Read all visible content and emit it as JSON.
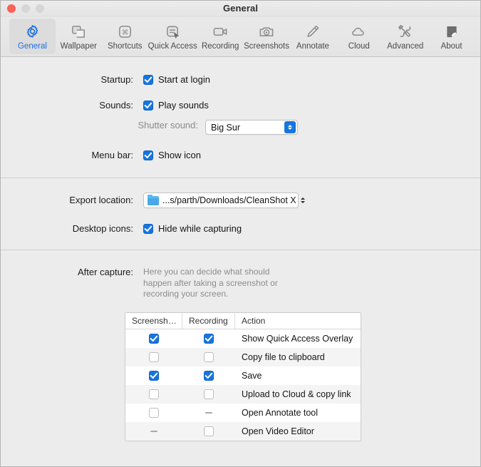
{
  "window": {
    "title": "General",
    "traffic_lights": [
      "close",
      "minimize",
      "zoom"
    ]
  },
  "toolbar": {
    "items": [
      {
        "label": "General",
        "icon": "gear-icon",
        "selected": true
      },
      {
        "label": "Wallpaper",
        "icon": "windows-icon",
        "selected": false
      },
      {
        "label": "Shortcuts",
        "icon": "command-key-icon",
        "selected": false
      },
      {
        "label": "Quick Access",
        "icon": "cursor-panel-icon",
        "selected": false
      },
      {
        "label": "Recording",
        "icon": "video-camera-icon",
        "selected": false
      },
      {
        "label": "Screenshots",
        "icon": "camera-icon",
        "selected": false
      },
      {
        "label": "Annotate",
        "icon": "pen-icon",
        "selected": false
      },
      {
        "label": "Cloud",
        "icon": "cloud-icon",
        "selected": false
      },
      {
        "label": "Advanced",
        "icon": "tools-icon",
        "selected": false
      },
      {
        "label": "About",
        "icon": "page-curl-icon",
        "selected": false
      }
    ]
  },
  "settings": {
    "startup": {
      "label": "Startup:",
      "checkbox_label": "Start at login",
      "checked": true
    },
    "sounds": {
      "label": "Sounds:",
      "checkbox_label": "Play sounds",
      "checked": true,
      "shutter": {
        "label": "Shutter sound:",
        "value": "Big Sur"
      }
    },
    "menu_bar": {
      "label": "Menu bar:",
      "checkbox_label": "Show icon",
      "checked": true
    },
    "export_location": {
      "label": "Export location:",
      "value": "...s/parth/Downloads/CleanShot X",
      "icon": "folder-icon"
    },
    "desktop_icons": {
      "label": "Desktop icons:",
      "checkbox_label": "Hide while capturing",
      "checked": true
    },
    "after_capture": {
      "label": "After capture:",
      "description": "Here you can decide what should happen after taking a screenshot or recording your screen.",
      "table": {
        "columns": [
          "Screensh…",
          "Recording",
          "Action"
        ],
        "rows": [
          {
            "screenshot": "checked",
            "recording": "checked",
            "action": "Show Quick Access Overlay"
          },
          {
            "screenshot": "unchecked",
            "recording": "unchecked",
            "action": "Copy file to clipboard"
          },
          {
            "screenshot": "checked",
            "recording": "checked",
            "action": "Save"
          },
          {
            "screenshot": "unchecked",
            "recording": "unchecked",
            "action": "Upload to Cloud & copy link"
          },
          {
            "screenshot": "unchecked",
            "recording": "disabled",
            "action": "Open Annotate tool"
          },
          {
            "screenshot": "disabled",
            "recording": "unchecked",
            "action": "Open Video Editor"
          }
        ]
      }
    }
  },
  "colors": {
    "accent": "#1675e0",
    "selected_tab_text": "#1d6ee3",
    "window_bg": "#ececec",
    "close_light": "#fa6159"
  }
}
